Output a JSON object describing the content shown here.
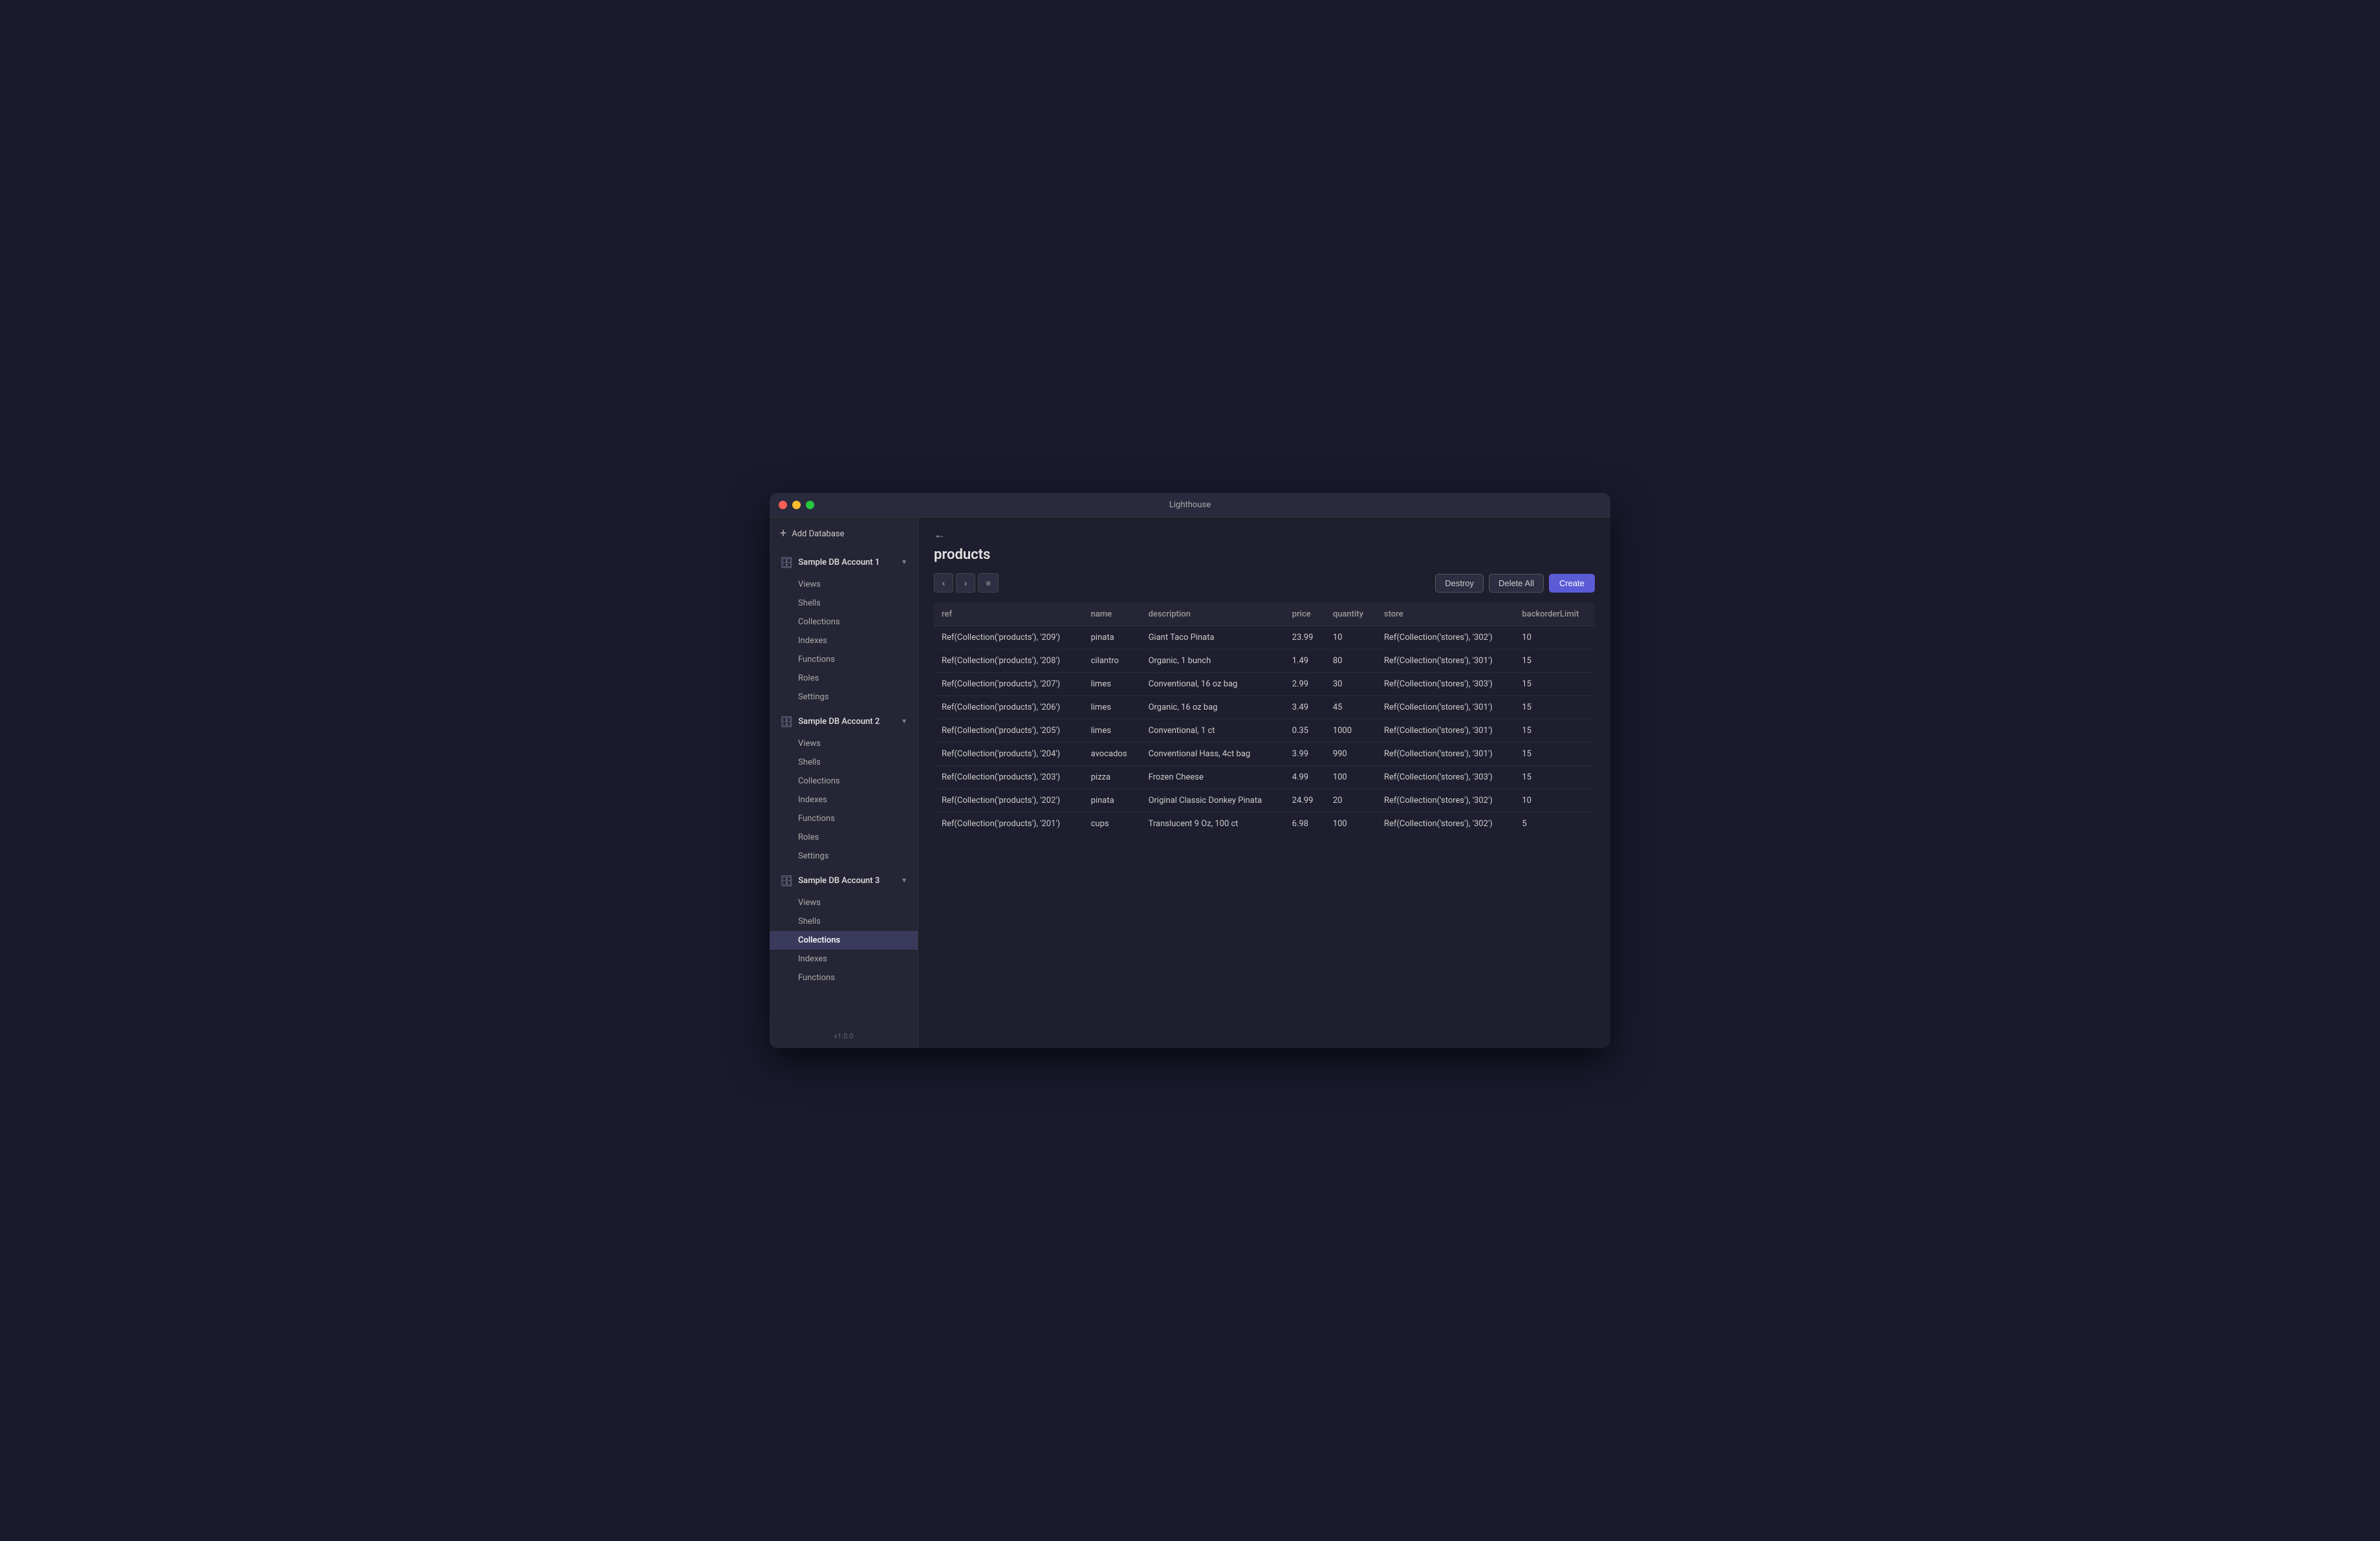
{
  "window": {
    "title": "Lighthouse"
  },
  "sidebar": {
    "add_db_label": "Add Database",
    "version": "v1.0.0",
    "databases": [
      {
        "id": "db1",
        "name": "Sample DB Account 1",
        "items": [
          "Views",
          "Shells",
          "Collections",
          "Indexes",
          "Functions",
          "Roles",
          "Settings"
        ]
      },
      {
        "id": "db2",
        "name": "Sample DB Account 2",
        "items": [
          "Views",
          "Shells",
          "Collections",
          "Indexes",
          "Functions",
          "Roles",
          "Settings"
        ]
      },
      {
        "id": "db3",
        "name": "Sample DB Account 3",
        "items": [
          "Views",
          "Shells",
          "Collections",
          "Indexes",
          "Functions"
        ]
      }
    ],
    "active_db": "db3",
    "active_item": "Collections"
  },
  "main": {
    "back_arrow": "←",
    "page_title": "products",
    "toolbar": {
      "prev_label": "‹",
      "next_label": "›",
      "filter_label": "≡",
      "destroy_label": "Destroy",
      "delete_all_label": "Delete All",
      "create_label": "Create"
    },
    "table": {
      "columns": [
        "ref",
        "name",
        "description",
        "price",
        "quantity",
        "store",
        "backorderLimit"
      ],
      "rows": [
        {
          "ref": "Ref(Collection('products'), '209')",
          "name": "pinata",
          "description": "Giant Taco Pinata",
          "price": "23.99",
          "quantity": "10",
          "store": "Ref(Collection('stores'), '302')",
          "backorderLimit": "10"
        },
        {
          "ref": "Ref(Collection('products'), '208')",
          "name": "cilantro",
          "description": "Organic, 1 bunch",
          "price": "1.49",
          "quantity": "80",
          "store": "Ref(Collection('stores'), '301')",
          "backorderLimit": "15"
        },
        {
          "ref": "Ref(Collection('products'), '207')",
          "name": "limes",
          "description": "Conventional, 16 oz bag",
          "price": "2.99",
          "quantity": "30",
          "store": "Ref(Collection('stores'), '303')",
          "backorderLimit": "15"
        },
        {
          "ref": "Ref(Collection('products'), '206')",
          "name": "limes",
          "description": "Organic, 16 oz bag",
          "price": "3.49",
          "quantity": "45",
          "store": "Ref(Collection('stores'), '301')",
          "backorderLimit": "15"
        },
        {
          "ref": "Ref(Collection('products'), '205')",
          "name": "limes",
          "description": "Conventional, 1 ct",
          "price": "0.35",
          "quantity": "1000",
          "store": "Ref(Collection('stores'), '301')",
          "backorderLimit": "15"
        },
        {
          "ref": "Ref(Collection('products'), '204')",
          "name": "avocados",
          "description": "Conventional Hass, 4ct bag",
          "price": "3.99",
          "quantity": "990",
          "store": "Ref(Collection('stores'), '301')",
          "backorderLimit": "15"
        },
        {
          "ref": "Ref(Collection('products'), '203')",
          "name": "pizza",
          "description": "Frozen Cheese",
          "price": "4.99",
          "quantity": "100",
          "store": "Ref(Collection('stores'), '303')",
          "backorderLimit": "15"
        },
        {
          "ref": "Ref(Collection('products'), '202')",
          "name": "pinata",
          "description": "Original Classic Donkey Pinata",
          "price": "24.99",
          "quantity": "20",
          "store": "Ref(Collection('stores'), '302')",
          "backorderLimit": "10"
        },
        {
          "ref": "Ref(Collection('products'), '201')",
          "name": "cups",
          "description": "Translucent 9 Oz, 100 ct",
          "price": "6.98",
          "quantity": "100",
          "store": "Ref(Collection('stores'), '302')",
          "backorderLimit": "5"
        }
      ]
    }
  }
}
